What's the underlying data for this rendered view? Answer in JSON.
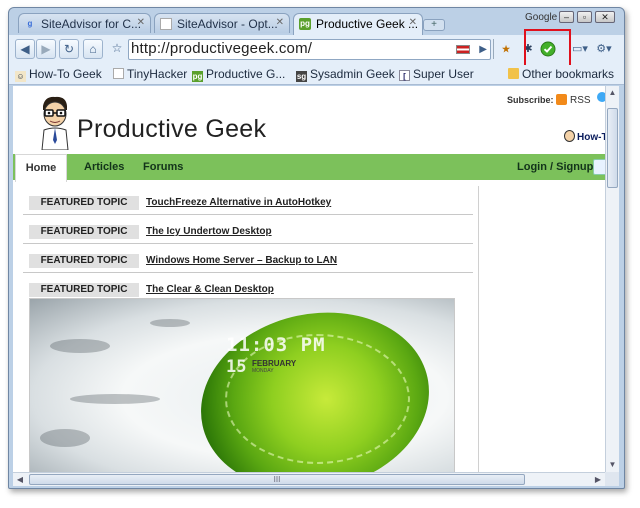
{
  "browser": {
    "tabs": [
      {
        "label": "SiteAdvisor for C...",
        "active": false
      },
      {
        "label": "SiteAdvisor - Opt...",
        "active": false
      },
      {
        "label": "Productive Geek ...",
        "active": true
      }
    ],
    "search_engine_label": "Google",
    "url": "http://productivegeek.com/",
    "bookmarks": [
      "How-To Geek",
      "TinyHacker",
      "Productive G...",
      "Sysadmin Geek",
      "Super User"
    ],
    "other_bookmarks": "Other bookmarks"
  },
  "site": {
    "name": "Productive Geek",
    "subscribe_label": "Subscribe:",
    "rss_label": "RSS",
    "partner_label": "How-To",
    "nav": {
      "home": "Home",
      "articles": "Articles",
      "forums": "Forums",
      "login": "Login / Signup"
    },
    "featured_tag": "FEATURED TOPIC",
    "featured": [
      "TouchFreeze Alternative in AutoHotkey",
      "The Icy Undertow Desktop",
      "Windows Home Server – Backup to LAN",
      "The Clear & Clean Desktop"
    ],
    "wallpaper": {
      "time": "11:03 PM",
      "day": "15",
      "month": "FEBRUARY",
      "weekday": "MONDAY"
    }
  },
  "scrollbar_grip": "III",
  "colors": {
    "nav_green": "#7cc15b",
    "highlight_red": "#e0101c",
    "siteadvisor_green": "#43b02a"
  }
}
